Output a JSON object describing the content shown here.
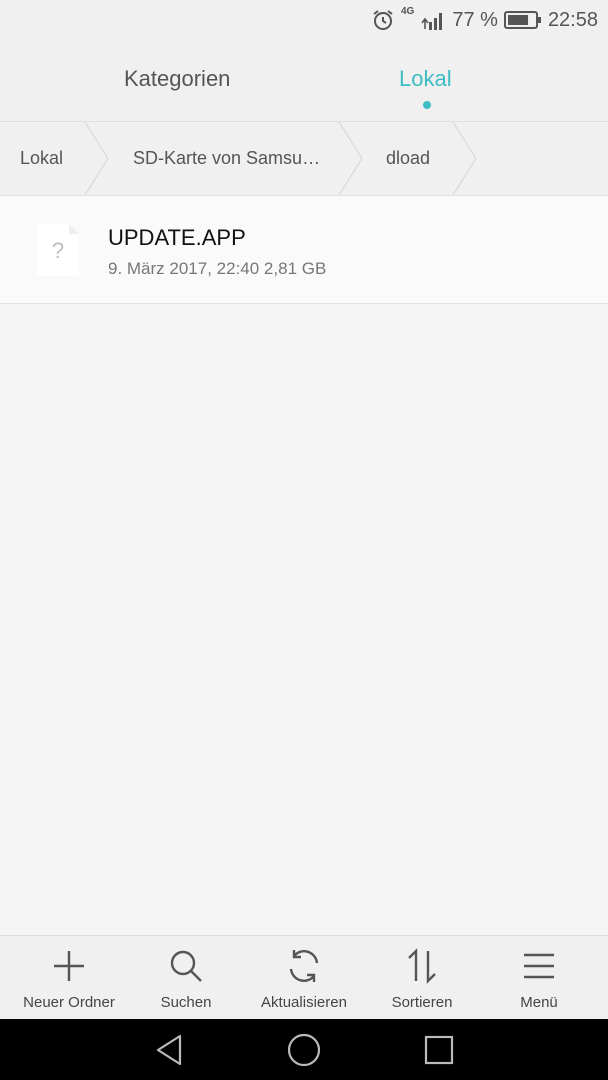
{
  "status": {
    "network": "4G",
    "battery_percent": "77 %",
    "battery_level": 0.77,
    "time": "22:58"
  },
  "tabs": [
    {
      "label": "Kategorien",
      "active": false
    },
    {
      "label": "Lokal",
      "active": true
    }
  ],
  "accent_color": "#3cbcc3",
  "breadcrumb": [
    "Lokal",
    "SD-Karte von Samsu…",
    "dload"
  ],
  "files": [
    {
      "name": "UPDATE.APP",
      "meta": "9. März 2017, 22:40 2,81 GB",
      "icon": "unknown-file-icon"
    }
  ],
  "actions": [
    {
      "label": "Neuer Ordner",
      "icon": "plus-icon"
    },
    {
      "label": "Suchen",
      "icon": "search-icon"
    },
    {
      "label": "Aktualisieren",
      "icon": "refresh-icon"
    },
    {
      "label": "Sortieren",
      "icon": "sort-icon"
    },
    {
      "label": "Menü",
      "icon": "menu-icon"
    }
  ],
  "nav": [
    "back-icon",
    "home-icon",
    "recents-icon"
  ]
}
